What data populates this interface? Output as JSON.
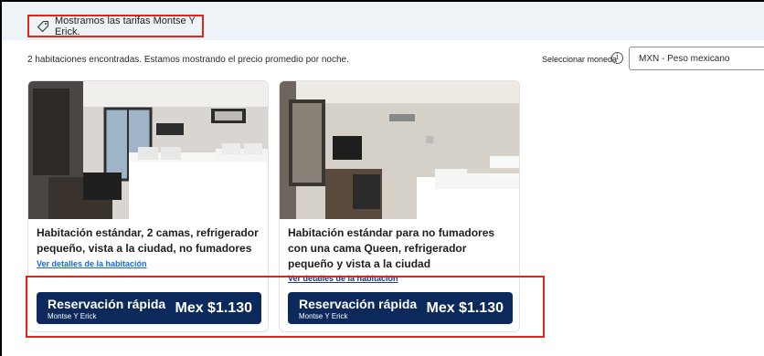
{
  "banner": {
    "text": "Mostramos las tarifas Montse Y Erick.",
    "icon": "tag-icon"
  },
  "info": {
    "rooms_found": "2 habitaciones encontradas. Estamos mostrando el precio promedio por noche.",
    "currency_label": "Seleccionar moneda",
    "currency_value": "MXN - Peso mexicano"
  },
  "rooms": [
    {
      "title": "Habitación estándar, 2 camas, refrigerador pequeño, vista a la ciudad, no fumadores",
      "details_link": "Ver detalles de la habitación",
      "button_label": "Reservación rápida",
      "button_sub": "Montse Y Erick",
      "price": "Mex $1.130"
    },
    {
      "title": "Habitación estándar para no fumadores con una cama Queen, refrigerador pequeño y vista a la ciudad",
      "details_link": "Ver detalles de la habitación",
      "button_label": "Reservación rápida",
      "button_sub": "Montse Y Erick",
      "price": "Mex $1.130"
    }
  ],
  "colors": {
    "button_bg": "#0b2a5b",
    "highlight": "#e0261b",
    "link": "#1668e3",
    "banner_bg": "#eef3f7"
  }
}
